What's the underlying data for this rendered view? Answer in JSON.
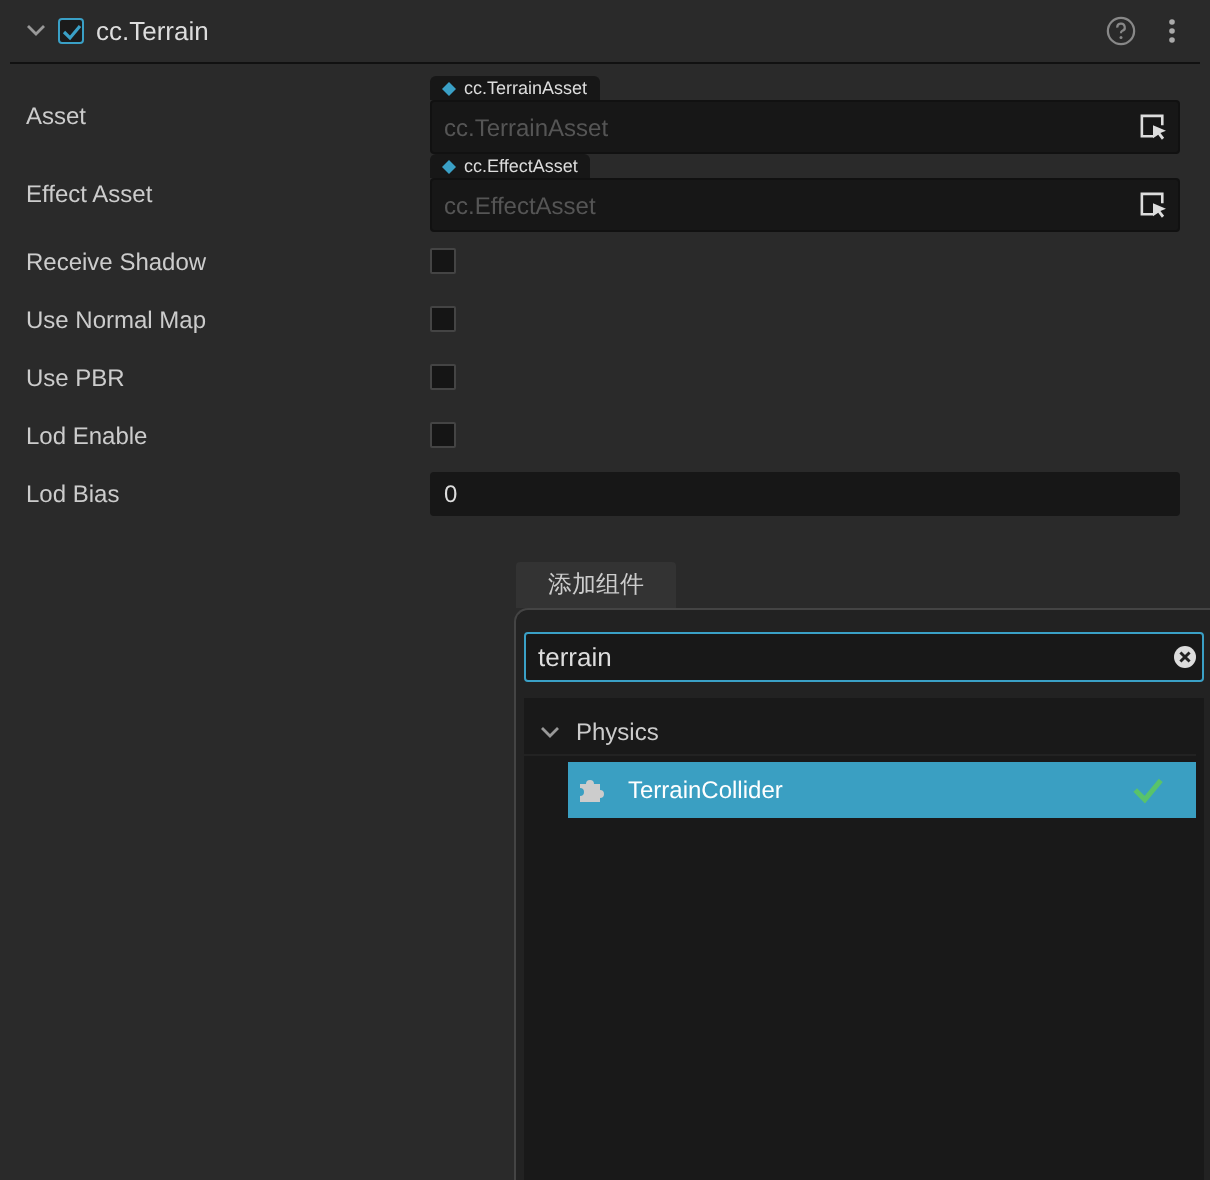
{
  "component": {
    "title": "cc.Terrain",
    "expanded": true,
    "enabled": true
  },
  "properties": [
    {
      "kind": "asset",
      "label": "Asset",
      "tag": "cc.TerrainAsset",
      "placeholder": "cc.TerrainAsset"
    },
    {
      "kind": "asset",
      "label": "Effect Asset",
      "tag": "cc.EffectAsset",
      "placeholder": "cc.EffectAsset"
    },
    {
      "kind": "checkbox",
      "label": "Receive Shadow",
      "checked": false
    },
    {
      "kind": "checkbox",
      "label": "Use Normal Map",
      "checked": false
    },
    {
      "kind": "checkbox",
      "label": "Use PBR",
      "checked": false
    },
    {
      "kind": "checkbox",
      "label": "Lod Enable",
      "checked": false
    },
    {
      "kind": "number",
      "label": "Lod Bias",
      "value": "0"
    }
  ],
  "add_button": "添加组件",
  "popup": {
    "search": {
      "value": "terrain"
    },
    "groups": [
      {
        "label": "Physics",
        "expanded": true,
        "children": [
          {
            "label": "TerrainCollider",
            "selected": true,
            "checked": true
          }
        ]
      }
    ]
  }
}
